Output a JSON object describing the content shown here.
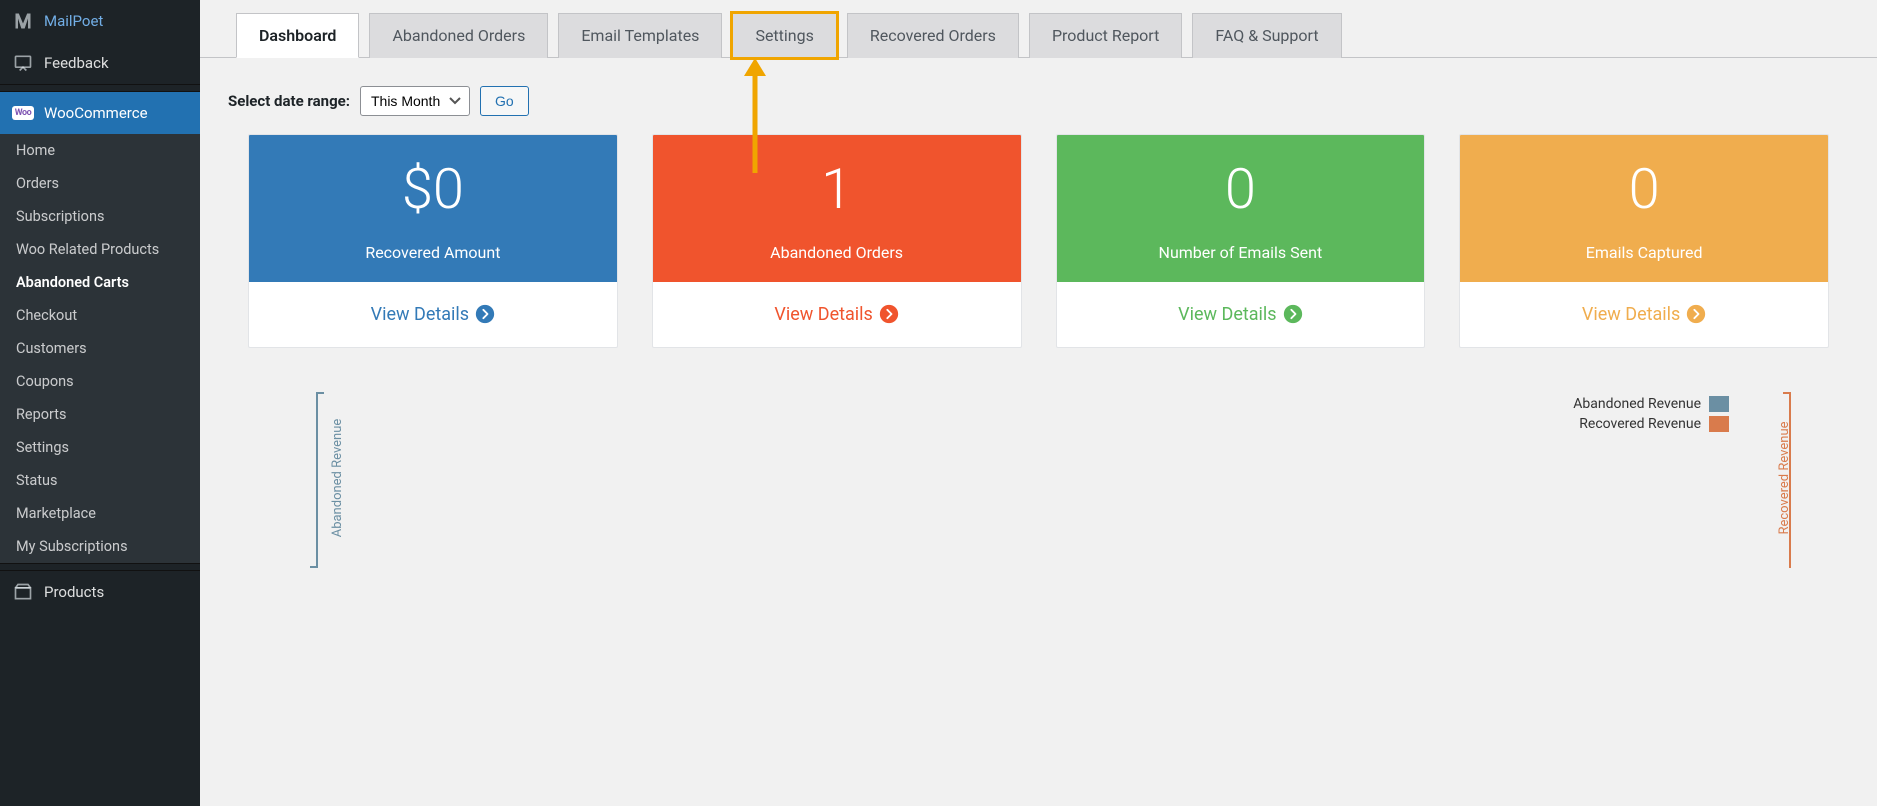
{
  "sidebar": {
    "mailpoet": "MailPoet",
    "feedback": "Feedback",
    "woocommerce": "WooCommerce",
    "products": "Products",
    "sub": [
      "Home",
      "Orders",
      "Subscriptions",
      "Woo Related Products",
      "Abandoned Carts",
      "Checkout",
      "Customers",
      "Coupons",
      "Reports",
      "Settings",
      "Status",
      "Marketplace",
      "My Subscriptions"
    ],
    "sub_current_index": 4
  },
  "tabs": [
    "Dashboard",
    "Abandoned Orders",
    "Email Templates",
    "Settings",
    "Recovered Orders",
    "Product Report",
    "FAQ & Support"
  ],
  "active_tab_index": 0,
  "highlighted_tab_index": 3,
  "date_range": {
    "label": "Select date range:",
    "selected": "This Month",
    "go": "Go"
  },
  "cards": [
    {
      "value": "$0",
      "label": "Recovered Amount",
      "link": "View Details",
      "color": "blue",
      "accent": "#337ab7"
    },
    {
      "value": "1",
      "label": "Abandoned Orders",
      "link": "View Details",
      "color": "orange",
      "accent": "#f0542d"
    },
    {
      "value": "0",
      "label": "Number of Emails Sent",
      "link": "View Details",
      "color": "green",
      "accent": "#5cb85c"
    },
    {
      "value": "0",
      "label": "Emails Captured",
      "link": "View Details",
      "color": "yellow",
      "accent": "#f0ad4e"
    }
  ],
  "chart": {
    "left_axis": "Abandoned Revenue",
    "right_axis": "Recovered Revenue",
    "legend": [
      {
        "label": "Abandoned Revenue",
        "color": "#6b8fa3"
      },
      {
        "label": "Recovered Revenue",
        "color": "#d97b4c"
      }
    ]
  },
  "chart_data": {
    "type": "bar",
    "series": [
      {
        "name": "Abandoned Revenue",
        "values": []
      },
      {
        "name": "Recovered Revenue",
        "values": []
      }
    ],
    "categories": [],
    "xlabel": "",
    "ylabel_left": "Abandoned Revenue",
    "ylabel_right": "Recovered Revenue"
  }
}
